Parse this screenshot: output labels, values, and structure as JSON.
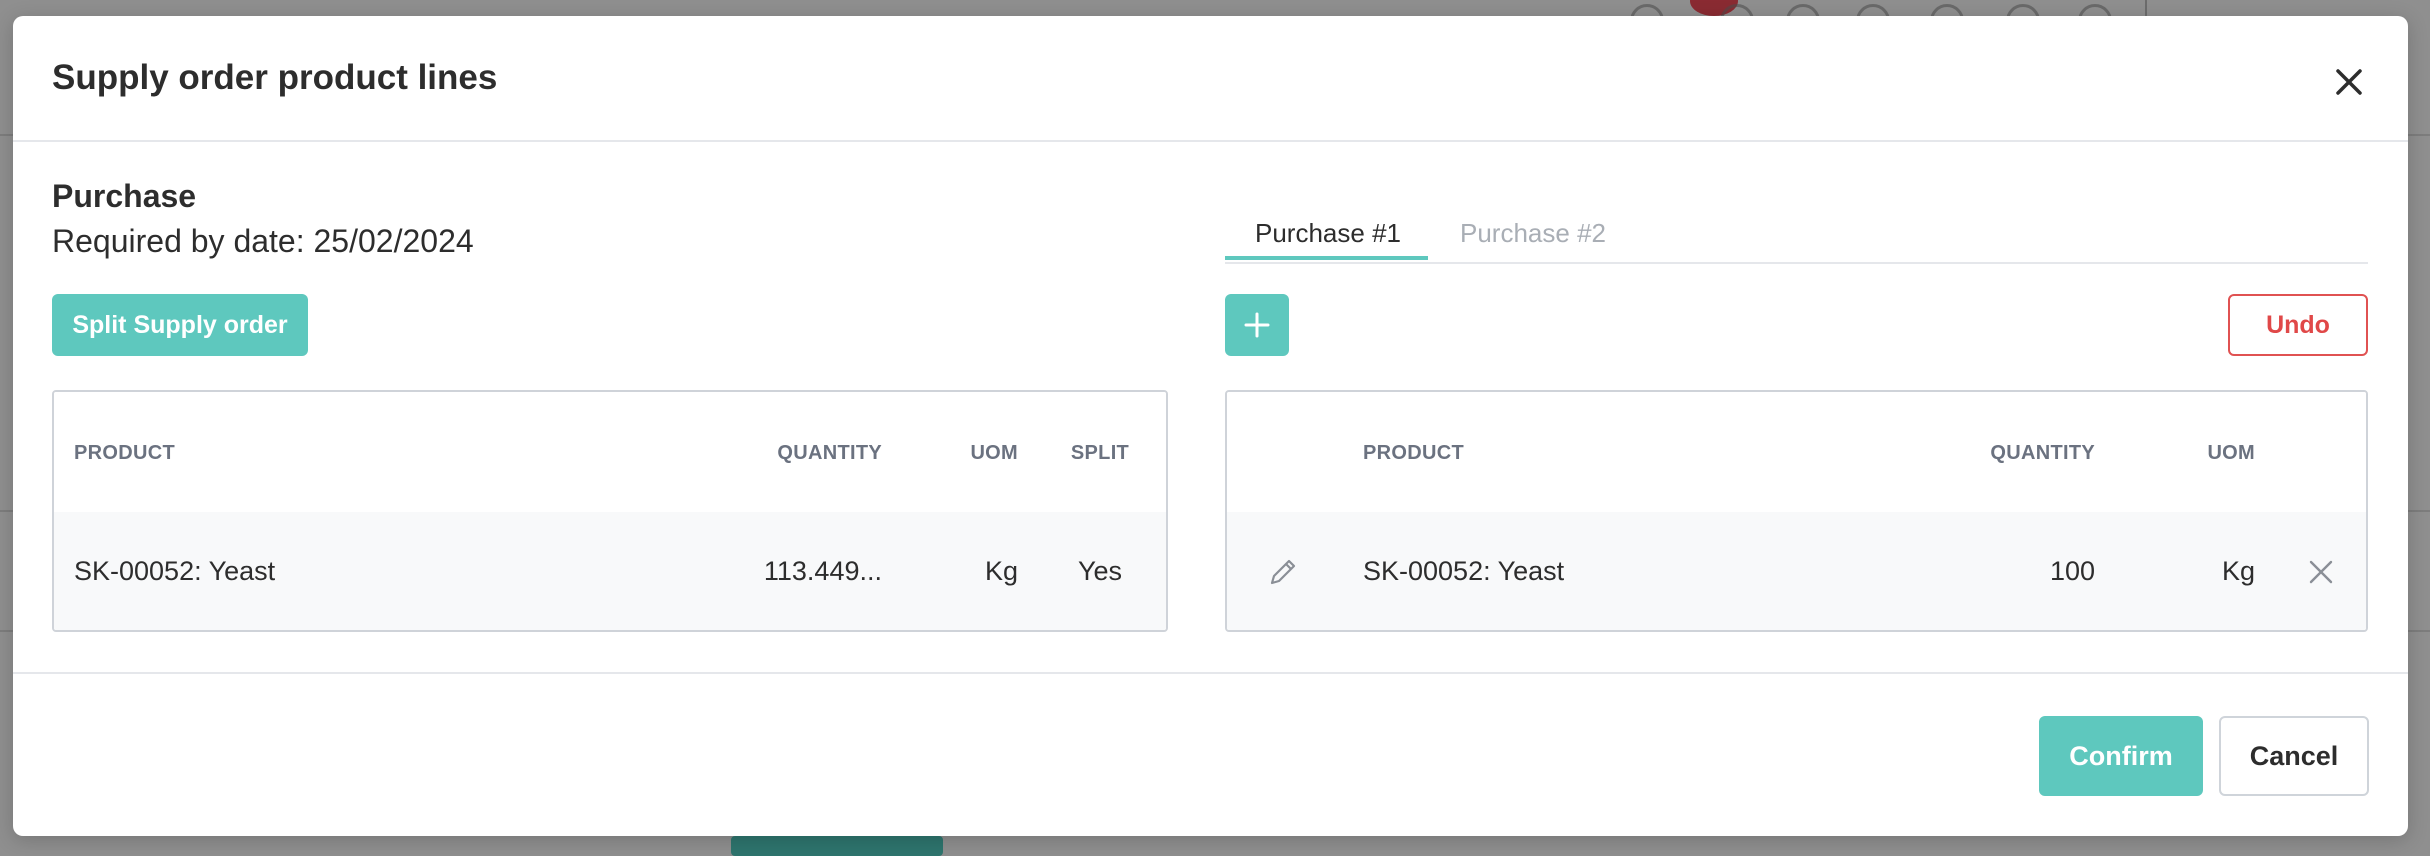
{
  "modal": {
    "title": "Supply order product lines",
    "close_label": "close"
  },
  "left": {
    "title": "Purchase",
    "required_by": "Required by date: 25/02/2024",
    "split_button": "Split Supply order",
    "columns": [
      "PRODUCT",
      "QUANTITY",
      "UOM",
      "SPLIT"
    ],
    "rows": [
      {
        "product": "SK-00052: Yeast",
        "quantity": "113.449...",
        "uom": "Kg",
        "split": "Yes"
      }
    ]
  },
  "right": {
    "tabs": [
      {
        "label": "Purchase #1",
        "active": true
      },
      {
        "label": "Purchase #2",
        "active": false
      }
    ],
    "undo_button": "Undo",
    "columns": [
      "PRODUCT",
      "QUANTITY",
      "UOM"
    ],
    "rows": [
      {
        "product": "SK-00052: Yeast",
        "quantity": "100",
        "uom": "Kg"
      }
    ]
  },
  "footer": {
    "confirm_button": "Confirm",
    "cancel_button": "Cancel"
  },
  "colors": {
    "accent": "#5ec8be",
    "danger": "#e04848",
    "overlay": "#8f8f8f"
  },
  "icons": [
    "close-icon",
    "plus-icon",
    "pencil-icon",
    "remove-x-icon"
  ]
}
